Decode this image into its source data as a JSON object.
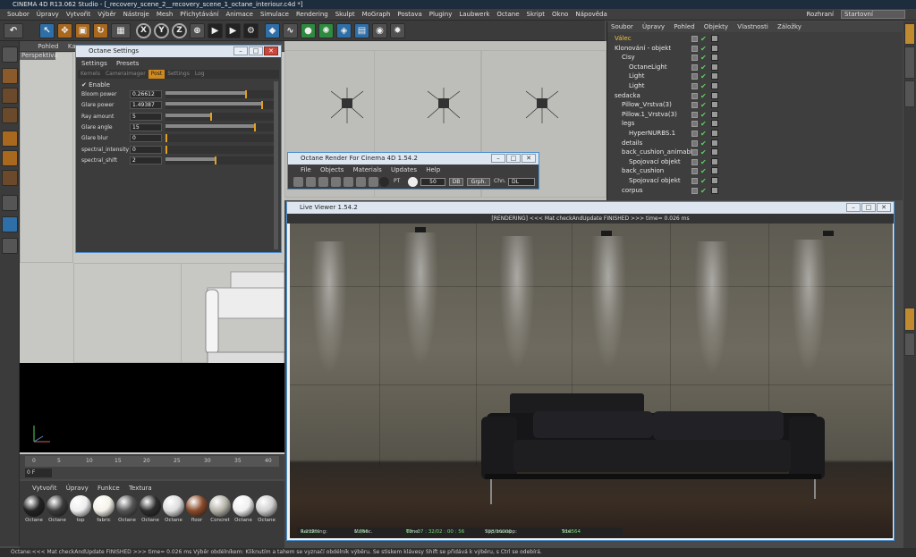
{
  "window_title": "CINEMA 4D R13.062 Studio - [_recovery_scene_2__recovery_scene_1_octane_interiour.c4d *]",
  "menu": [
    "Soubor",
    "Úpravy",
    "Vytvořit",
    "Výběr",
    "Nástroje",
    "Mesh",
    "Přichytávání",
    "Animace",
    "Simulace",
    "Rendering",
    "Skulpt",
    "MoGraph",
    "Postava",
    "Pluginy",
    "Laubwerk",
    "Octane",
    "Skript",
    "Okno",
    "Nápověda"
  ],
  "layout": {
    "label": "Rozhraní",
    "value": "Startovní"
  },
  "toolbar": {
    "x": "X",
    "y": "Y",
    "z": "Z"
  },
  "viewport": {
    "menu": [
      "Pohled",
      "Kamery"
    ],
    "label": "Perspektiva"
  },
  "timeline": {
    "ticks": [
      "0",
      "5",
      "10",
      "15",
      "20",
      "25",
      "30",
      "35",
      "40"
    ],
    "frame": "0 F"
  },
  "material_manager": {
    "menu": [
      "Vytvořit",
      "Úpravy",
      "Funkce",
      "Textura"
    ],
    "materials": [
      {
        "name": "Octane",
        "color": "#222"
      },
      {
        "name": "Octane",
        "color": "#3a3a3a"
      },
      {
        "name": "top",
        "color": "#eee"
      },
      {
        "name": "fabric",
        "color": "#f4f2e8"
      },
      {
        "name": "Octane",
        "color": "#555"
      },
      {
        "name": "Octane",
        "color": "#2c2c2c"
      },
      {
        "name": "Octane",
        "color": "#ddd"
      },
      {
        "name": "floor",
        "color": "#8a4a2a"
      },
      {
        "name": "Concret",
        "color": "#b5b2a8"
      },
      {
        "name": "Octane",
        "color": "#f0f0f0"
      },
      {
        "name": "Octane",
        "color": "#cfcfcf"
      }
    ]
  },
  "status_bar": "Octane:<<< Mat checkAndUpdate  FINISHED >>> time= 0.026 ms         Výběr obdélníkem: Kliknutím a tahem se vyznačí obdélník výběru. Se stiskem klávesy Shift se přidává k výběru, s Ctrl se odebírá.",
  "object_manager": {
    "menu": [
      "Soubor",
      "Úpravy",
      "Pohled",
      "Objekty",
      "Vlastnosti",
      "Záložky"
    ],
    "items": [
      {
        "name": "Válec",
        "indent": 0,
        "highlight": true
      },
      {
        "name": "Klonování - objekt",
        "indent": 0
      },
      {
        "name": "Cisy",
        "indent": 1
      },
      {
        "name": "OctaneLight",
        "indent": 2
      },
      {
        "name": "Light",
        "indent": 2
      },
      {
        "name": "Light",
        "indent": 2
      },
      {
        "name": "sedacka",
        "indent": 0
      },
      {
        "name": "Pillow_Vrstva(3)",
        "indent": 1
      },
      {
        "name": "Pillow.1_Vrstva(3)",
        "indent": 1
      },
      {
        "name": "legs",
        "indent": 1
      },
      {
        "name": "HyperNURBS.1",
        "indent": 2
      },
      {
        "name": "details",
        "indent": 1
      },
      {
        "name": "back_cushion_animable",
        "indent": 1
      },
      {
        "name": "Spojovací objekt",
        "indent": 2
      },
      {
        "name": "back_cushion",
        "indent": 1
      },
      {
        "name": "Spojovací objekt",
        "indent": 2
      },
      {
        "name": "corpus",
        "indent": 1
      }
    ]
  },
  "octane_settings": {
    "title": "Octane Settings",
    "menu": [
      "Settings",
      "Presets"
    ],
    "tabs": [
      "Kernels",
      "Cameraimager",
      "Post",
      "Settings",
      "Log"
    ],
    "active_tab": "Post",
    "enable_label": "Enable",
    "params": [
      {
        "label": "Bloom power",
        "value": "0.26612",
        "frac": 0.72
      },
      {
        "label": "Glare power",
        "value": "1.49387",
        "frac": 0.86
      },
      {
        "label": "Ray amount",
        "value": "5",
        "frac": 0.4
      },
      {
        "label": "Glare angle",
        "value": "15",
        "frac": 0.8
      },
      {
        "label": "Glare blur",
        "value": "0",
        "frac": 0
      },
      {
        "label": "spectral_intensity",
        "value": "0",
        "frac": 0
      },
      {
        "label": "spectral_shift",
        "value": "2",
        "frac": 0.44
      }
    ]
  },
  "octane_render": {
    "title": "Octane Render For Cinema 4D 1.54.2",
    "menu": [
      "File",
      "Objects",
      "Materials",
      "Updates",
      "Help"
    ],
    "pt_label": "PT",
    "samples": "50",
    "db_label": "DB",
    "graph_label": "Grph.",
    "chn_label": "Chn.",
    "chn_value": "DL"
  },
  "live_viewer": {
    "title": "Live Viewer 1.54.2",
    "status": "[RENDERING] <<< Mat checkAndUpdate  FINISHED >>> time= 0.026 ms",
    "stats": {
      "rendering_label": "Rendering:",
      "rendering_value": "6.237%",
      "ms_label": "Ms/sec.",
      "ms_value": "1.766",
      "time_label": "Time:",
      "time_value": "00 : 07 : 32/02 : 00 : 56",
      "spp_label": "Spp/maxspp:",
      "spp_value": "998/16000",
      "tris_label": "Tris:",
      "tris_value": "514564"
    }
  }
}
